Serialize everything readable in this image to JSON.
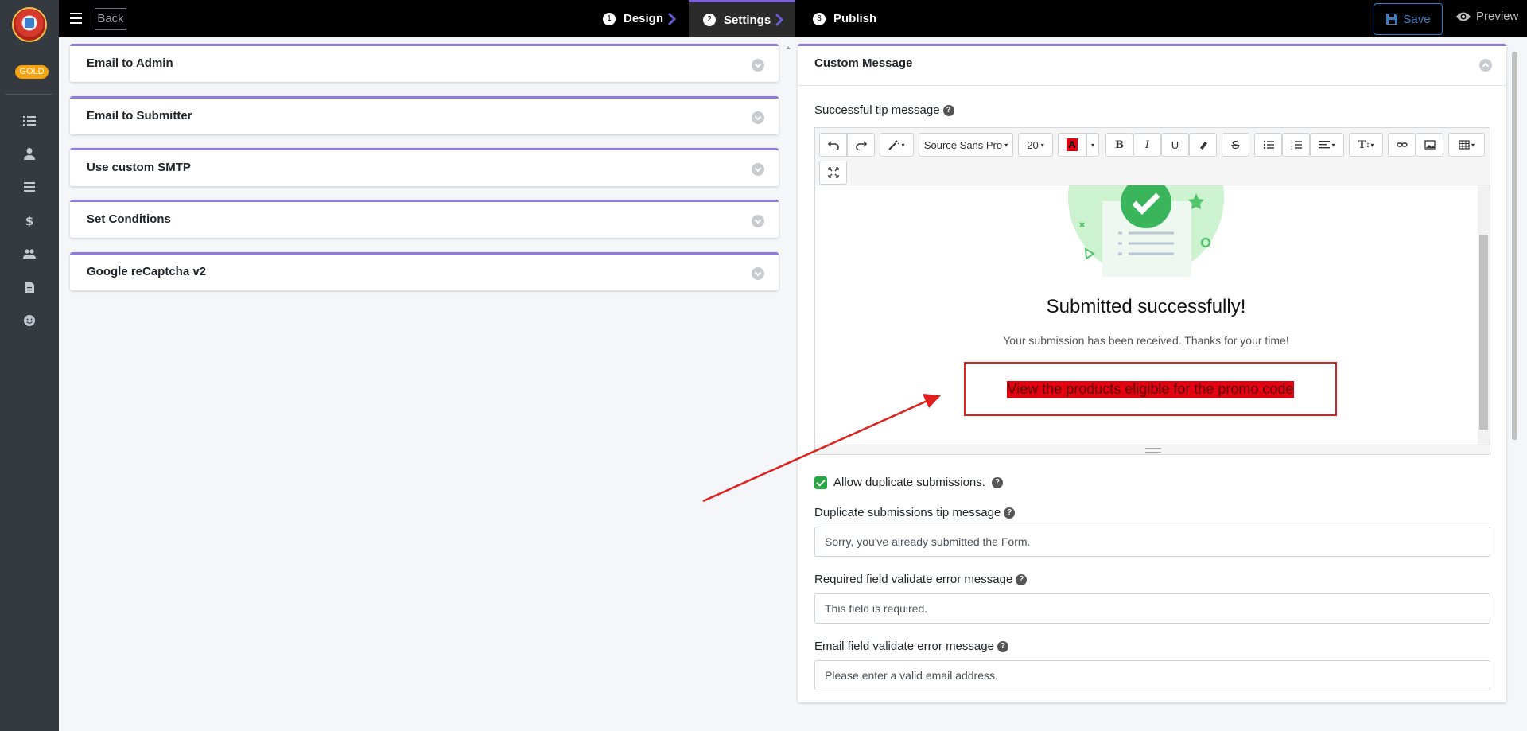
{
  "sidebar": {
    "badge": "GOLD",
    "items": [
      "list-icon",
      "user-icon",
      "menu-icon",
      "dollar-icon",
      "users-icon",
      "file-icon",
      "smile-icon"
    ]
  },
  "topbar": {
    "back_label": "Back",
    "steps": [
      {
        "num": "1",
        "label": "Design"
      },
      {
        "num": "2",
        "label": "Settings"
      },
      {
        "num": "3",
        "label": "Publish"
      }
    ],
    "save_label": "Save",
    "preview_label": "Preview"
  },
  "left_panels": [
    "Email to Admin",
    "Email to Submitter",
    "Use custom SMTP",
    "Set Conditions",
    "Google reCaptcha v2"
  ],
  "custom_message": {
    "title": "Custom Message",
    "success_label": "Successful tip message",
    "toolbar": {
      "font_family": "Source Sans Pro",
      "font_size": "20"
    },
    "content": {
      "heading": "Submitted successfully!",
      "subtext": "Your submission has been received. Thanks for your time!",
      "promo": "View the products eligible for the promo code"
    },
    "allow_duplicate_label": "Allow duplicate submissions.",
    "allow_duplicate_checked": true,
    "duplicate_label": "Duplicate submissions tip message",
    "duplicate_value": "Sorry, you've already submitted the Form.",
    "required_label": "Required field validate error message",
    "required_value": "This field is required.",
    "email_label": "Email field validate error message",
    "email_value": "Please enter a valid email address."
  },
  "colors": {
    "accent": "#8e7bdb",
    "save": "#3a7dc4",
    "promo_bg": "#e3000f",
    "annotation": "#e0201c"
  }
}
